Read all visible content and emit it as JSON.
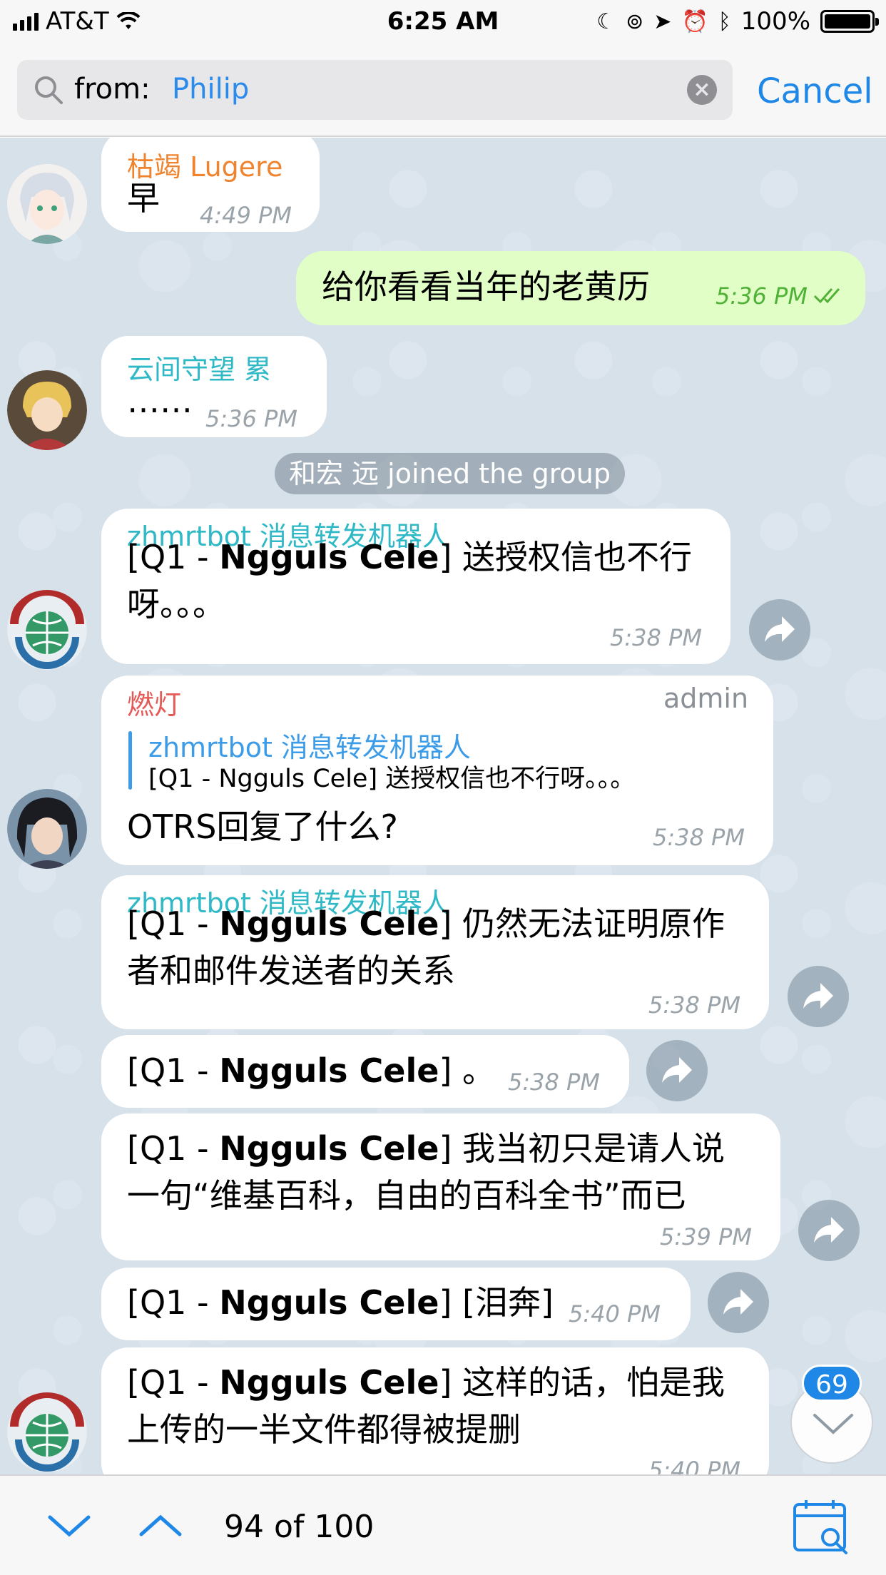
{
  "status_bar": {
    "carrier": "AT&T",
    "time": "6:25 AM",
    "battery": "100%"
  },
  "search": {
    "prefix": "from:",
    "value": "Philip",
    "cancel_label": "Cancel"
  },
  "messages": [
    {
      "sender": "枯竭 Lugere",
      "sender_color": "#f0832e",
      "text": "早",
      "time": "4:49 PM"
    },
    {
      "outgoing": true,
      "text": "给你看看当年的老黄历",
      "time": "5:36 PM"
    },
    {
      "sender": "云间守望 累",
      "sender_color": "#2fb8c6",
      "text": "……",
      "time": "5:36 PM"
    },
    {
      "service": "和宏 远 joined the group"
    },
    {
      "sender": "zhmrtbot 消息转发机器人",
      "sender_color": "#2fb8c6",
      "prefix": "[Q1 - ",
      "bold": "Ngguls Cele",
      "line1": "] 送授权信也不行",
      "line2": "呀。。。",
      "time": "5:38 PM"
    },
    {
      "sender": "燃灯",
      "sender_color": "#e45a56",
      "badge": "admin",
      "reply_name": "zhmrtbot 消息转发机器人",
      "reply_text": "[Q1 - Ngguls Cele] 送授权信也不行呀。。。",
      "text": "OTRS回复了什么?",
      "time": "5:38 PM"
    },
    {
      "sender": "zhmrtbot 消息转发机器人",
      "sender_color": "#2fb8c6",
      "prefix": "[Q1 - ",
      "bold": "Ngguls Cele",
      "line1": "] 仍然无法证明原作",
      "line2": "者和邮件发送者的关系",
      "time": "5:38 PM"
    },
    {
      "prefix": "[Q1 - ",
      "bold": "Ngguls Cele",
      "line1": "] 。",
      "time": "5:38 PM"
    },
    {
      "prefix": "[Q1 - ",
      "bold": "Ngguls Cele",
      "line1": "] 我当初只是请人说",
      "line2": "一句“维基百科，自由的百科全书”而已",
      "time": "5:39 PM"
    },
    {
      "prefix": "[Q1 - ",
      "bold": "Ngguls Cele",
      "line1": "] [泪奔]",
      "time": "5:40 PM"
    },
    {
      "prefix": "[Q1 - ",
      "bold": "Ngguls Cele",
      "line1": "] 这样的话，怕是我",
      "line2": "上传的一半文件都得被提删",
      "time": "5:40 PM"
    }
  ],
  "unread_badge": "69",
  "bottom": {
    "counter": "94 of 100"
  },
  "colors": {
    "accent": "#1f87e6",
    "outgoing_bubble": "#e1fec6",
    "chat_background": "#d6e1ea"
  },
  "icons": [
    "search-icon",
    "clear-icon",
    "read-checkmarks-icon",
    "forward-icon",
    "chevron-down-icon",
    "chevron-up-icon",
    "calendar-search-icon",
    "wifi-icon",
    "moon-icon",
    "alarm-icon",
    "bluetooth-icon",
    "location-icon"
  ]
}
